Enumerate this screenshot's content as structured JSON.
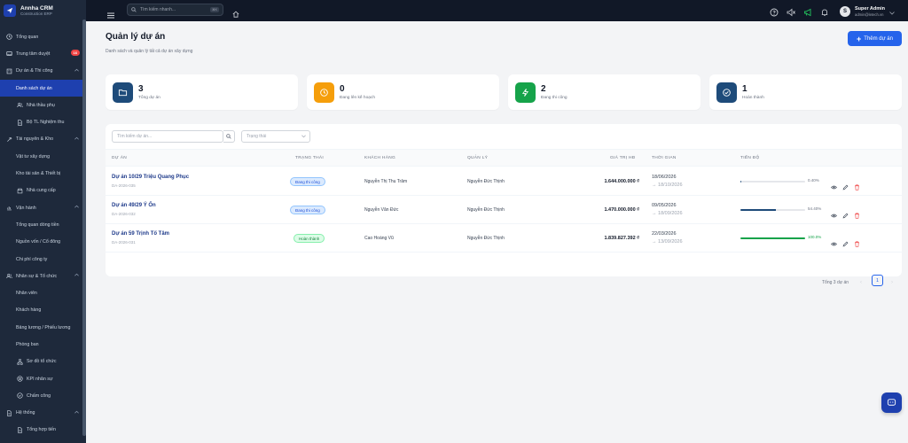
{
  "brand": {
    "title": "Annha CRM",
    "subtitle": "Construction ERP"
  },
  "sidebar": {
    "items": [
      {
        "label": "Tổng quan"
      },
      {
        "label": "Trung tâm duyệt",
        "badge": "16"
      },
      {
        "label": "Dự án & Thi công"
      },
      {
        "label": "Danh sách dự án"
      },
      {
        "label": "Nhà thầu phụ"
      },
      {
        "label": "Bộ TL Nghiệm thu"
      },
      {
        "label": "Tài nguyên & Kho"
      },
      {
        "label": "Vật tư xây dựng"
      },
      {
        "label": "Kho tài sản & Thiết bị"
      },
      {
        "label": "Nhà cung cấp"
      },
      {
        "label": "Vận hành"
      },
      {
        "label": "Tổng quan dòng tiền"
      },
      {
        "label": "Nguồn vốn / Cổ đông"
      },
      {
        "label": "Chi phí công ty"
      },
      {
        "label": "Nhân sự & Tổ chức"
      },
      {
        "label": "Nhân viên"
      },
      {
        "label": "Khách hàng"
      },
      {
        "label": "Bảng lương / Phiếu lương"
      },
      {
        "label": "Phòng ban"
      },
      {
        "label": "Sơ đồ tổ chức"
      },
      {
        "label": "KPI nhân sự"
      },
      {
        "label": "Chấm công"
      },
      {
        "label": "Hệ thống"
      },
      {
        "label": "Tổng hợp tiến"
      }
    ]
  },
  "topbar": {
    "search_placeholder": "Tìm kiếm nhanh...",
    "search_shortcut": "⌘K",
    "user_name": "Super Admin",
    "user_email": "admin@letech.vn",
    "avatar_letter": "S"
  },
  "page": {
    "title": "Quản lý dự án",
    "subtitle": "Danh sách và quản lý tất cả dự án xây dựng",
    "add_button": "Thêm dự án"
  },
  "stats": [
    {
      "value": "3",
      "label": "Tổng dự án",
      "color": "#1e4b7a"
    },
    {
      "value": "0",
      "label": "Đang lên kế hoạch",
      "color": "#f59e0b"
    },
    {
      "value": "2",
      "label": "Đang thi công",
      "color": "#16a34a"
    },
    {
      "value": "1",
      "label": "Hoàn thành",
      "color": "#1e4b7a"
    }
  ],
  "filters": {
    "search_placeholder": "Tìm kiếm dự án...",
    "status_placeholder": "Trạng thái"
  },
  "table": {
    "headers": [
      "DỰ ÁN",
      "TRẠNG THÁI",
      "KHÁCH HÀNG",
      "QUẢN LÝ",
      "GIÁ TRỊ HĐ",
      "THỜI GIAN",
      "TIẾN ĐỘ"
    ],
    "rows": [
      {
        "name": "Dự án 10/29 Triệu Quang Phục",
        "code": "DA-2026-035",
        "status": "Đang thi công",
        "status_type": "blue",
        "customer": "Nguyễn Thị Thu Trâm",
        "manager": "Nguyễn Đức Thịnh",
        "value": "1.644.000.000 ₫",
        "start": "18/06/2026",
        "end": "→ 18/10/2026",
        "progress": 0.4,
        "progress_text": "0.40%",
        "bar_color": "#1e4b7a"
      },
      {
        "name": "Dự án 49/29 Ý Ốn",
        "code": "DA-2026-032",
        "status": "Đang thi công",
        "status_type": "blue",
        "customer": "Nguyễn Văn Đức",
        "manager": "Nguyễn Đức Thịnh",
        "value": "1.470.000.000 ₫",
        "start": "09/05/2026",
        "end": "→ 18/09/2026",
        "progress": 54.4,
        "progress_text": "54.40%",
        "bar_color": "#1e4b7a"
      },
      {
        "name": "Dự án 59 Trịnh Tố Tâm",
        "code": "DA-2026-031",
        "status": "Hoàn thành",
        "status_type": "green",
        "customer": "Cao Hoàng Vũ",
        "manager": "Nguyễn Đức Thịnh",
        "value": "1.839.827.392 ₫",
        "start": "22/03/2026",
        "end": "→ 13/09/2026",
        "progress": 100,
        "progress_text": "100.0%",
        "bar_color": "#16a34a"
      }
    ]
  },
  "pagination": {
    "summary": "Tổng 3 dự án",
    "current": "1"
  }
}
